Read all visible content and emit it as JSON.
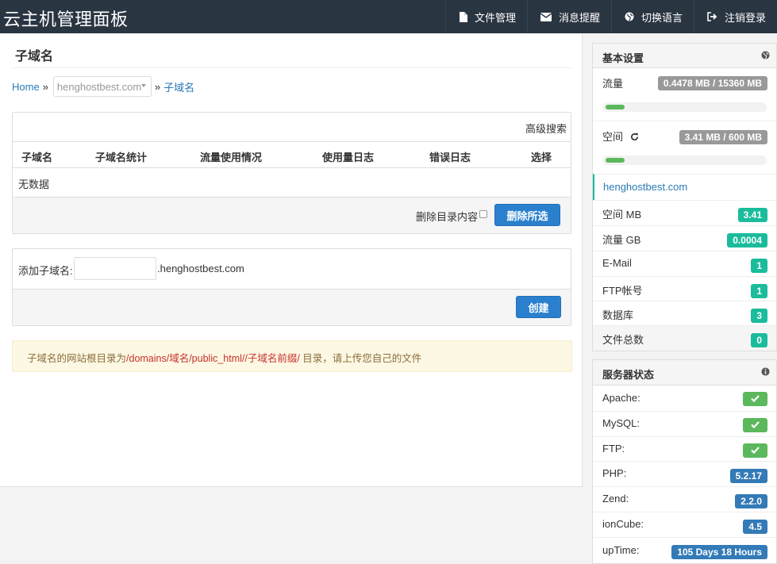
{
  "header": {
    "brand": "云主机管理面板",
    "nav": [
      {
        "label": "文件管理",
        "icon": "file-icon"
      },
      {
        "label": "消息提醒",
        "icon": "envelope-icon"
      },
      {
        "label": "切换语言",
        "icon": "globe-icon"
      },
      {
        "label": "注销登录",
        "icon": "sign-out-icon"
      }
    ]
  },
  "main": {
    "title": "子域名",
    "breadcrumb": {
      "home": "Home",
      "sep": "»",
      "domain": "henghostbest.com",
      "current": "子域名"
    },
    "table": {
      "advanced_search": "高级搜索",
      "columns": [
        "子域名",
        "子域名统计",
        "流量使用情况",
        "使用量日志",
        "错误日志",
        "选择"
      ],
      "empty": "无数据",
      "delete_dir_label": "删除目录内容",
      "delete_button": "删除所选"
    },
    "add": {
      "label": "添加子域名:",
      "input_value": "",
      "suffix": ".henghostbest.com",
      "create_button": "创建"
    },
    "notice": {
      "part1": "子域名的网站根目录为",
      "path": "/domains/域名/public_html//子域名前缀/",
      "part2": " 目录，请上传您自己的文件"
    }
  },
  "sidebar": {
    "basic": {
      "title": "基本设置",
      "traffic_label": "流量",
      "traffic_value": "0.4478 MB / 15360 MB",
      "traffic_fraction": 3e-05,
      "space_label": "空间",
      "space_value": "3.41 MB / 600 MB",
      "space_fraction": 0.0057,
      "domain": "henghostbest.com",
      "stats": [
        {
          "label": "空间 MB",
          "value": "3.41"
        },
        {
          "label": "流量 GB",
          "value": "0.0004"
        },
        {
          "label": "E-Mail",
          "value": "1"
        },
        {
          "label": "FTP帐号",
          "value": "1"
        },
        {
          "label": "数据库",
          "value": "3"
        },
        {
          "label": "文件总数",
          "value": "0"
        }
      ]
    },
    "server": {
      "title": "服务器状态",
      "items": [
        {
          "label": "Apache:",
          "type": "ok"
        },
        {
          "label": "MySQL:",
          "type": "ok"
        },
        {
          "label": "FTP:",
          "type": "ok"
        },
        {
          "label": "PHP:",
          "value": "5.2.17"
        },
        {
          "label": "Zend:",
          "value": "2.2.0"
        },
        {
          "label": "ionCube:",
          "value": "4.5"
        },
        {
          "label": "upTime:",
          "value": "105 Days 18 Hours"
        }
      ]
    }
  },
  "colors": {
    "topbar": "#2a3542",
    "link": "#2a7ab5",
    "teal": "#1abc9c",
    "green": "#5cb85c",
    "blue": "#337ab7",
    "button": "#2b80cd"
  }
}
